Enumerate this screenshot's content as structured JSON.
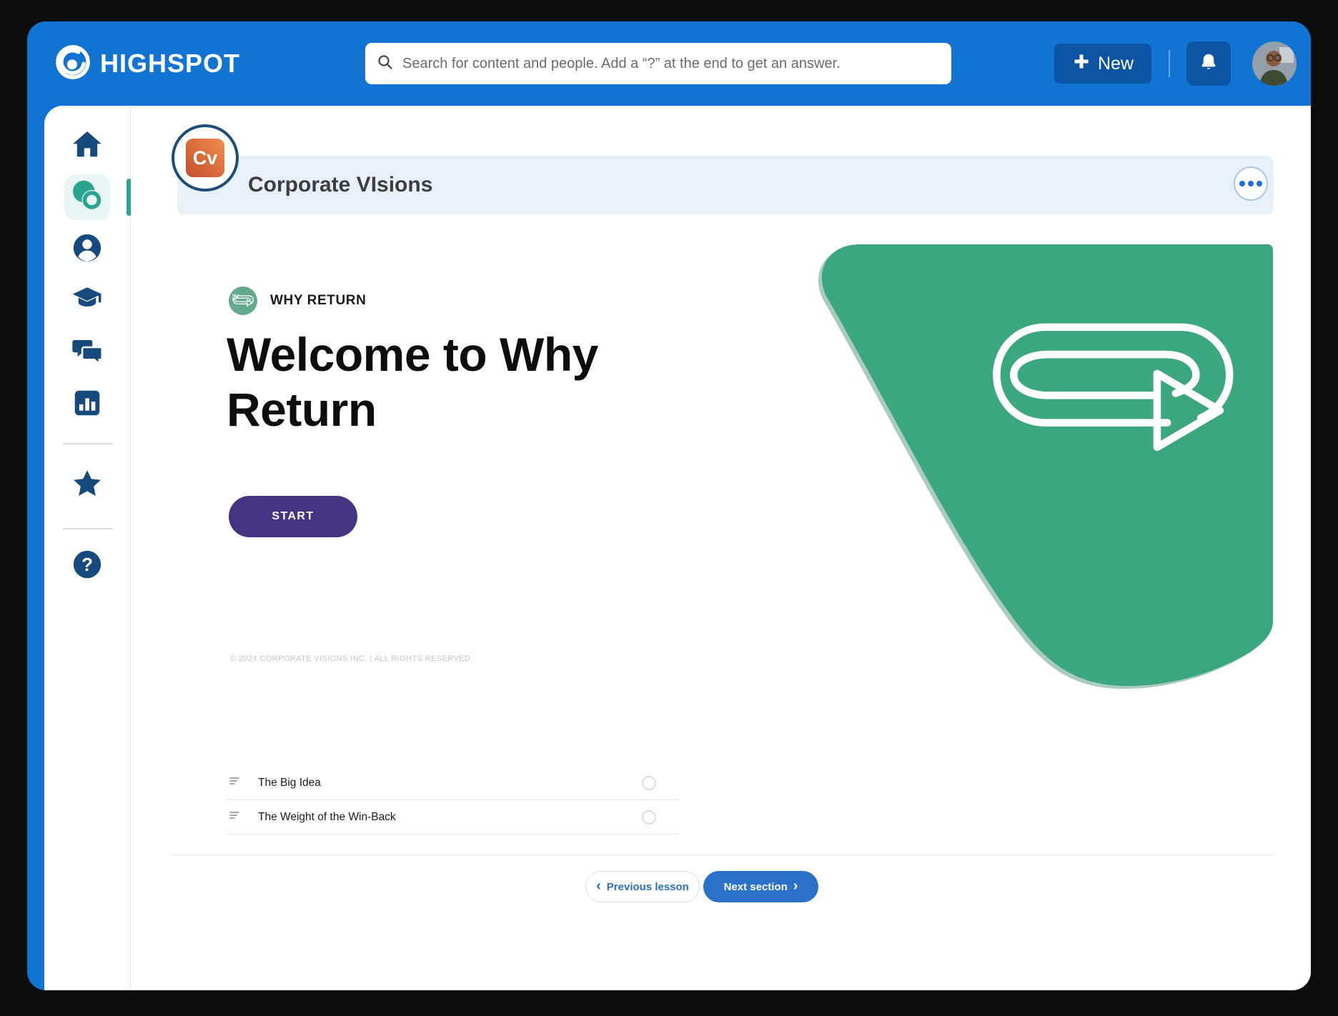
{
  "colors": {
    "accent_blue": "#1173d2",
    "dark_blue": "#0c55a5",
    "navy": "#174a7c",
    "teal": "#2aa391",
    "teal_bg": "#e9f5f4",
    "green_blob": "#3aa77d",
    "badge_green": "#63aa8d",
    "purple": "#453482",
    "link_blue": "#2a6fc4",
    "bar_bg": "#e8f1fa",
    "next_blue": "#2b70c9"
  },
  "header": {
    "brand": "HIGHSPOT",
    "search_placeholder": "Search for content and people. Add a “?” at the end to get an answer.",
    "new_label": "New"
  },
  "sidebar": {
    "items": [
      "home",
      "spots",
      "people",
      "training",
      "conversations",
      "analytics",
      "favorites",
      "help"
    ]
  },
  "spot_bar": {
    "title": "Corporate VIsions",
    "logo_text": "Cv"
  },
  "hero": {
    "eyebrow": "WHY RETURN",
    "title": "Welcome to Why Return",
    "start_label": "START",
    "copyright": "© 2024 CORPORATE VISIONS INC. | ALL RIGHTS RESERVED"
  },
  "lessons": [
    {
      "label": "The Big Idea"
    },
    {
      "label": "The Weight of the Win-Back"
    }
  ],
  "footer": {
    "prev_label": "Previous lesson",
    "next_label": "Next section"
  },
  "icons": {
    "chevron_left": "‹",
    "chevron_right": "›",
    "question_glyph": "?"
  }
}
